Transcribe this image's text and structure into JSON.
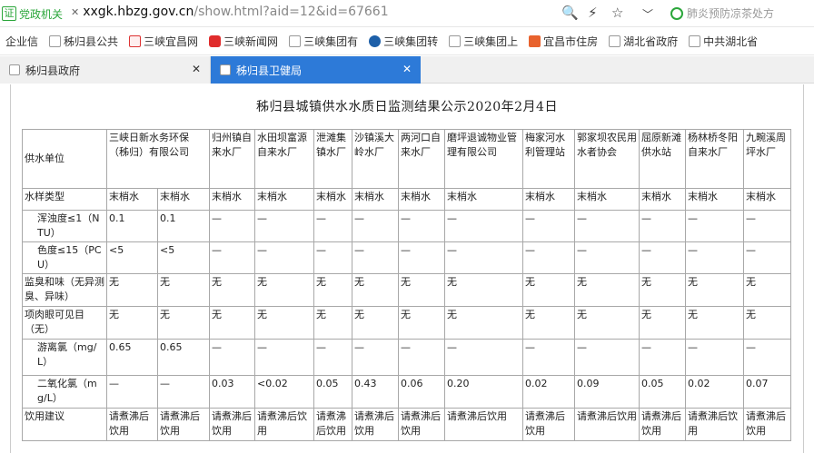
{
  "browser": {
    "badge_icon": "证",
    "badge_label": "党政机关",
    "url_domain": "xxgk.hbzg.gov.cn",
    "url_path": "/show.html?aid=12&id=67661",
    "search_hint": "肺炎预防凉茶处方"
  },
  "favorites": [
    {
      "label": "企业信",
      "icon": "page-icon"
    },
    {
      "label": "秭归县公共",
      "icon": "page-icon"
    },
    {
      "label": "三峡宜昌网",
      "icon": "red-logo-icon"
    },
    {
      "label": "三峡新闻网",
      "icon": "red-s-logo-icon"
    },
    {
      "label": "三峡集团有",
      "icon": "page-icon"
    },
    {
      "label": "三峡集团转",
      "icon": "blue-globe-icon"
    },
    {
      "label": "三峡集团上",
      "icon": "page-icon"
    },
    {
      "label": "宜昌市住房",
      "icon": "orange-logo-icon"
    },
    {
      "label": "湖北省政府",
      "icon": "page-icon"
    },
    {
      "label": "中共湖北省",
      "icon": "page-icon"
    }
  ],
  "tabs": [
    {
      "label": "秭归县政府",
      "active": false
    },
    {
      "label": "秭归县卫健局",
      "active": true
    }
  ],
  "page": {
    "title": "秭归县城镇供水水质日监测结果公示2020年2月4日"
  },
  "table": {
    "header": [
      "供水单位",
      "三峡日新水务环保（秭归）有限公司",
      "归州镇自来水厂",
      "水田坝富源自来水厂",
      "泄滩集镇水厂",
      "沙镇溪大岭水厂",
      "两河口自来水厂",
      "磨坪退诚物业管理有限公司",
      "梅家河水利管理站",
      "郭家坝农民用水者协会",
      "屈原新滩供水站",
      "杨林桥冬阳自来水厂",
      "九畹溪周坪水厂"
    ],
    "rows": [
      {
        "label": "水样类型",
        "indent": false,
        "cells": [
          "末梢水",
          "末梢水",
          "末梢水",
          "末梢水",
          "末梢水",
          "末梢水",
          "末梢水",
          "末梢水",
          "末梢水",
          "末梢水",
          "末梢水",
          "末梢水",
          "末梢水"
        ]
      },
      {
        "label": "浑浊度≤1（NTU）",
        "indent": true,
        "cells": [
          "0.1",
          "0.1",
          "—",
          "—",
          "—",
          "—",
          "—",
          "—",
          "—",
          "—",
          "—",
          "—",
          "—"
        ]
      },
      {
        "label": "色度≤15（PCU）",
        "indent": true,
        "cells": [
          "<5",
          "<5",
          "—",
          "—",
          "—",
          "—",
          "—",
          "—",
          "—",
          "—",
          "—",
          "—",
          "—"
        ]
      },
      {
        "label": "监臭和味（无异测臭、异味）",
        "indent": false,
        "cells": [
          "无",
          "无",
          "无",
          "无",
          "无",
          "无",
          "无",
          "无",
          "无",
          "无",
          "无",
          "无",
          "无"
        ]
      },
      {
        "label": "项肉眼可见目（无）",
        "indent": false,
        "cells": [
          "无",
          "无",
          "无",
          "无",
          "无",
          "无",
          "无",
          "无",
          "无",
          "无",
          "无",
          "无",
          "无"
        ]
      },
      {
        "label": "游离氯（mg/L）",
        "indent": true,
        "cells": [
          "0.65",
          "0.65",
          "—",
          "—",
          "—",
          "—",
          "—",
          "—",
          "—",
          "—",
          "—",
          "—",
          "—"
        ]
      },
      {
        "label": "二氧化氯（mg/L）",
        "indent": true,
        "cells": [
          "—",
          "—",
          "0.03",
          "<0.02",
          "0.05",
          "0.43",
          "0.06",
          "0.20",
          "0.02",
          "0.09",
          "0.05",
          "0.02",
          "0.07"
        ]
      },
      {
        "label": "饮用建议",
        "indent": false,
        "cells": [
          "请煮沸后饮用",
          "请煮沸后饮用",
          "请煮沸后饮用",
          "请煮沸后饮用",
          "请煮沸后饮用",
          "请煮沸后饮用",
          "请煮沸后饮用",
          "请煮沸后饮用",
          "请煮沸后饮用",
          "请煮沸后饮用",
          "请煮沸后饮用",
          "请煮沸后饮用",
          "请煮沸后饮用"
        ]
      }
    ]
  }
}
